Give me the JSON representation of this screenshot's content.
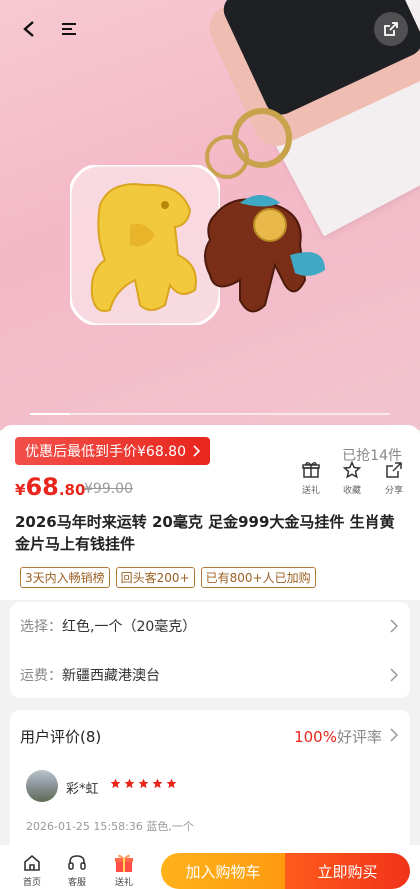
{
  "hero": {
    "back_icon": "chevron-left-icon",
    "menu_icon": "menu-icon",
    "share_icon": "share-icon",
    "image_alt": "horse keychain pendants product photo"
  },
  "product": {
    "promo_label": "优惠后最低到手价¥68.80",
    "grabbed": "已抢14件",
    "price_symbol": "¥",
    "price_int": "68",
    "price_dec": ".80",
    "original_price": "¥99.00",
    "title": "2026马年时来运转 20毫克 足金999大金马挂件 生肖黄金片马上有钱挂件",
    "tags": [
      "3天内入畅销榜",
      "回头客200+",
      "已有800+人已加购"
    ],
    "actions": [
      {
        "label": "送礼",
        "icon": "gift-icon"
      },
      {
        "label": "收藏",
        "icon": "star-icon"
      },
      {
        "label": "分享",
        "icon": "share-icon"
      }
    ]
  },
  "options": {
    "select_key": "选择：",
    "select_value": "红色,一个（20毫克）",
    "shipping_key": "运费：",
    "shipping_value": "新疆西藏港澳台"
  },
  "reviews": {
    "header": "用户评价(8)",
    "rate_percent": "100%",
    "rate_label": "好评率",
    "user": "彩*虹",
    "stars": 5,
    "meta": "2026-01-25 15:58:36 蓝色,一个"
  },
  "bottom": {
    "home": "首页",
    "service": "客服",
    "gift": "送礼",
    "add_cart": "加入购物车",
    "buy_now": "立即购买"
  },
  "colors": {
    "accent": "#e8261d",
    "cart": "#ffa215",
    "buy": "#f4421a",
    "tag": "#9c6024"
  }
}
